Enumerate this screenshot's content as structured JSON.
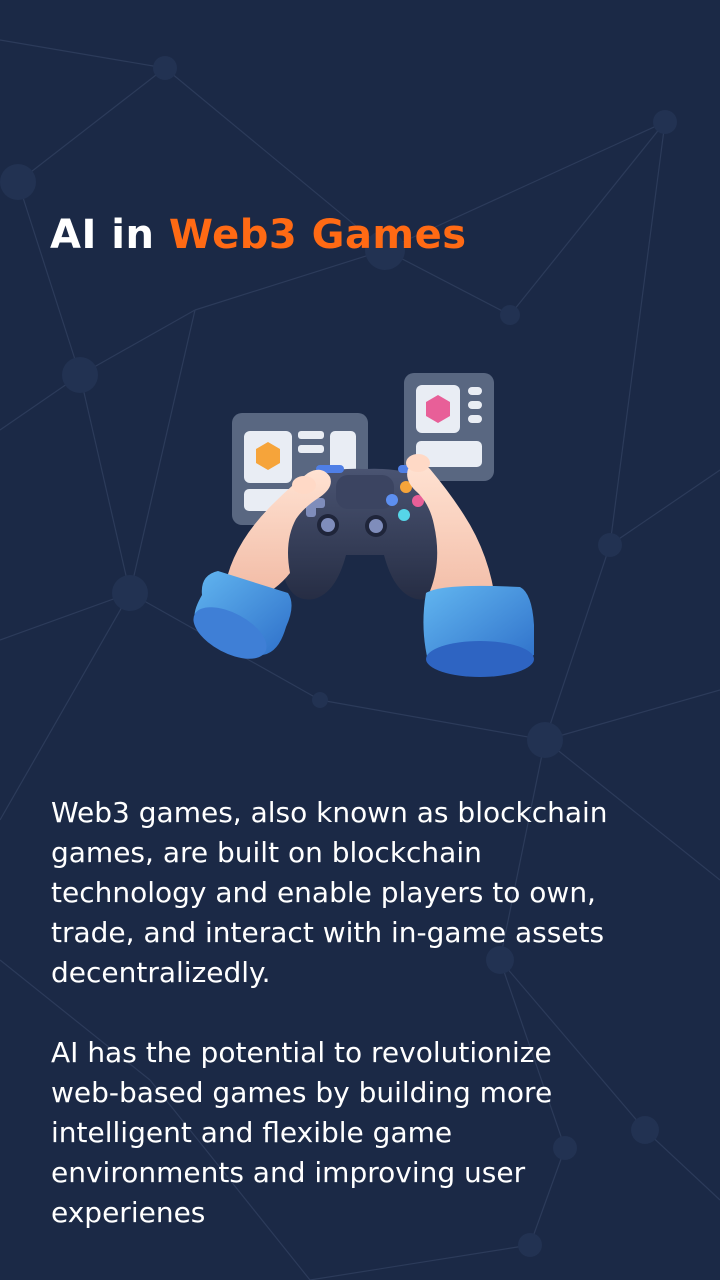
{
  "title": {
    "lead": "AI in",
    "accent": "Web3 Games"
  },
  "illustration": {
    "icon": "gamepad-hands-illustration"
  },
  "paragraphs": [
    "Web3 games, also known as blockchain\ngames, are built on blockchain\ntechnology and enable players to own,\ntrade, and interact with in-game assets\ndecentralizedly.",
    "AI has the potential to revolutionize\nweb-based games by building more\nintelligent and flexible game\nenvironments and improving user\nexperienes"
  ],
  "colors": {
    "background": "#1b2946",
    "accent": "#ff6a14",
    "text": "#ffffff"
  }
}
